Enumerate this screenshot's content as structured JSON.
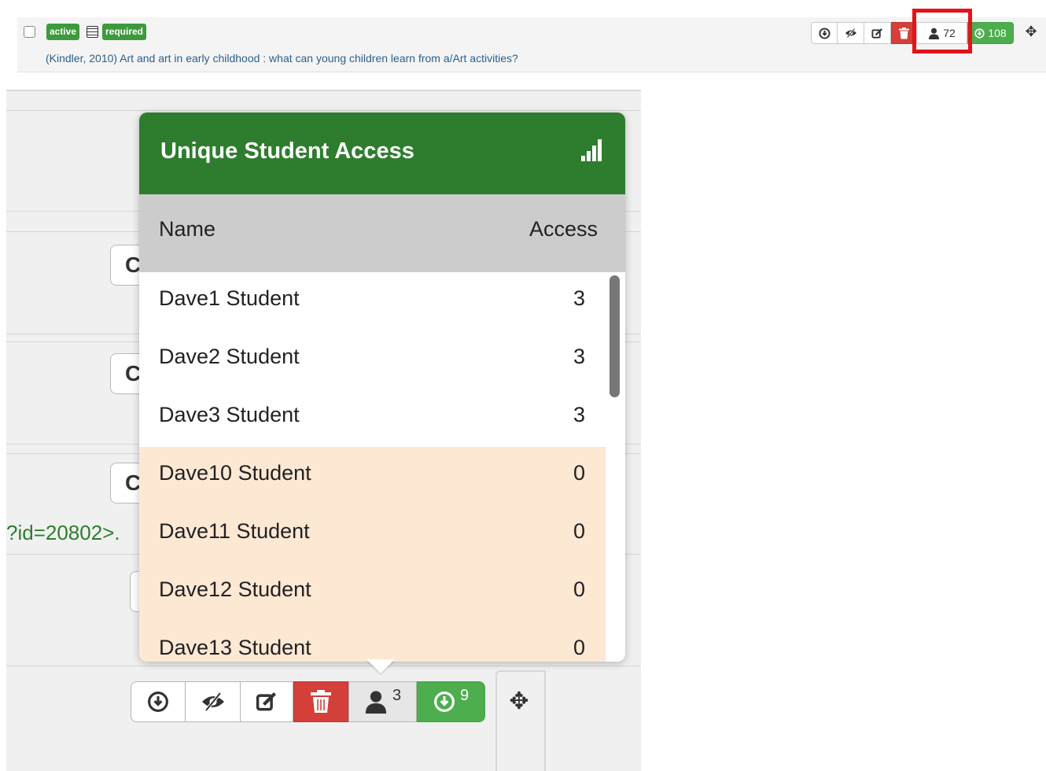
{
  "top_row": {
    "tags": {
      "active": "active",
      "required": "required"
    },
    "citation": "(Kindler, 2010) Art and art in early childhood : what can young children learn from a/Art activities?",
    "toolbar": {
      "download_icon": "⊕",
      "hide_icon": "◈",
      "edit_icon": "✎",
      "delete_icon": "🗑",
      "students_count": "72",
      "downloads_count": "108",
      "move_icon": "✥"
    }
  },
  "background": {
    "id_link_text": "?id=20802>.",
    "stub_glyph": "C"
  },
  "popover": {
    "title": "Unique Student Access",
    "columns": {
      "name": "Name",
      "access": "Access"
    },
    "rows": [
      {
        "name": "Dave1 Student",
        "access": "3",
        "highlighted": false
      },
      {
        "name": "Dave2 Student",
        "access": "3",
        "highlighted": false
      },
      {
        "name": "Dave3 Student",
        "access": "3",
        "highlighted": false
      },
      {
        "name": "Dave10 Student",
        "access": "0",
        "highlighted": true
      },
      {
        "name": "Dave11 Student",
        "access": "0",
        "highlighted": true
      },
      {
        "name": "Dave12 Student",
        "access": "0",
        "highlighted": true
      },
      {
        "name": "Dave13 Student",
        "access": "0",
        "highlighted": true
      }
    ]
  },
  "zoom_toolbar": {
    "students_count": "3",
    "downloads_count": "9"
  },
  "colors": {
    "header_green": "#2e7d2e",
    "zero_access_row": "#fde8d4",
    "delete_red": "#d43f3a",
    "success_green": "#4cae4c",
    "highlight_red": "#e0151c"
  }
}
